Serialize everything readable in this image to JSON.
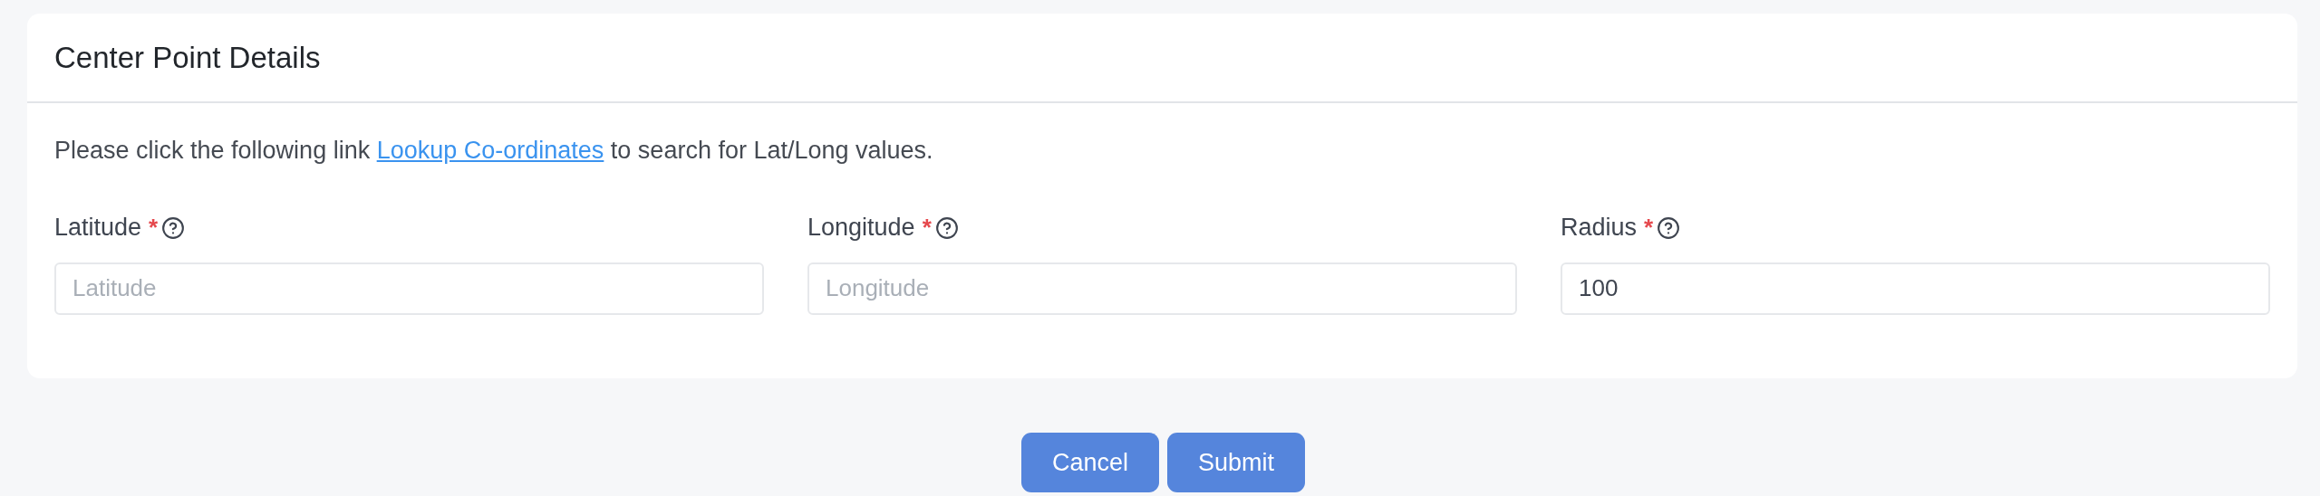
{
  "card": {
    "title": "Center Point Details"
  },
  "notice": {
    "before": "Please click the following link ",
    "link": "Lookup Co-ordinates",
    "after": " to search for Lat/Long values."
  },
  "fields": [
    {
      "label": "Latitude",
      "required": true,
      "placeholder": "Latitude"
    },
    {
      "label": "Longitude",
      "required": true,
      "placeholder": "Longitude"
    },
    {
      "label": "Radius",
      "required": true,
      "value": "100"
    }
  ],
  "required_mark": "*",
  "buttons": [
    "Cancel",
    "Submit"
  ]
}
